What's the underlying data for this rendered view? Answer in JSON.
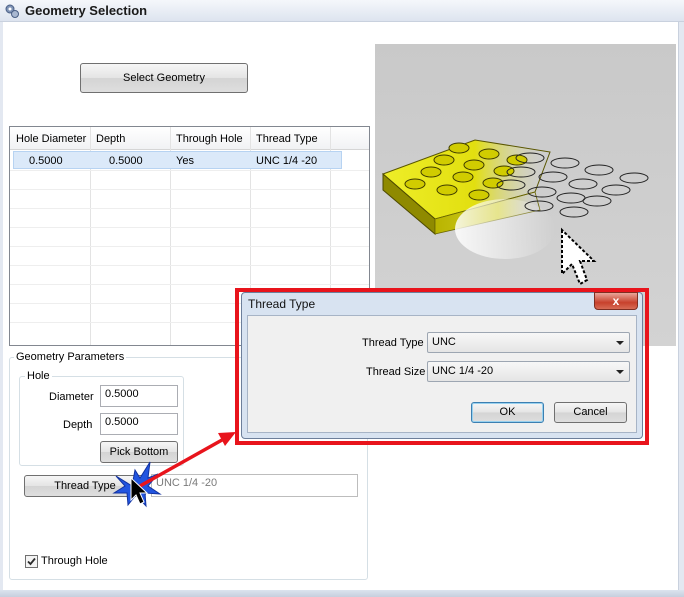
{
  "window": {
    "title": "Geometry Selection"
  },
  "buttons": {
    "select_geometry": "Select Geometry",
    "pick_bottom": "Pick Bottom",
    "thread_type": "Thread Type"
  },
  "table": {
    "columns": [
      "Hole Diameter",
      "Depth",
      "Through Hole",
      "Thread Type"
    ],
    "rows": [
      {
        "hole_diameter": "0.5000",
        "depth": "0.5000",
        "through_hole": "Yes",
        "thread_type": "UNC 1/4 -20"
      }
    ]
  },
  "geometry_parameters": {
    "group_label": "Geometry Parameters",
    "hole_group_label": "Hole",
    "diameter_label": "Diameter",
    "diameter_value": "0.5000",
    "depth_label": "Depth",
    "depth_value": "0.5000",
    "thread_value": "UNC 1/4 -20",
    "through_hole_label": "Through Hole",
    "through_hole_checked": true
  },
  "dialog": {
    "title": "Thread Type",
    "close_label": "x",
    "thread_type_label": "Thread Type",
    "thread_type_value": "UNC",
    "thread_size_label": "Thread Size",
    "thread_size_value": "UNC 1/4 -20",
    "ok_label": "OK",
    "cancel_label": "Cancel"
  },
  "colors": {
    "highlight_frame": "#e8141c",
    "arrow": "#e8141c",
    "part_yellow": "#e5e000",
    "row_selected": "#dbe9f9"
  }
}
